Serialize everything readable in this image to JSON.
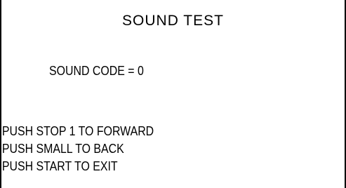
{
  "screen": {
    "title": "SOUND TEST",
    "code_line": "SOUND CODE = 0",
    "instructions": [
      "PUSH STOP 1 TO FORWARD",
      "PUSH SMALL TO BACK",
      "PUSH START TO EXIT"
    ]
  },
  "colors": {
    "background": "#ffffff",
    "text": "#000000",
    "border": "#000000"
  }
}
